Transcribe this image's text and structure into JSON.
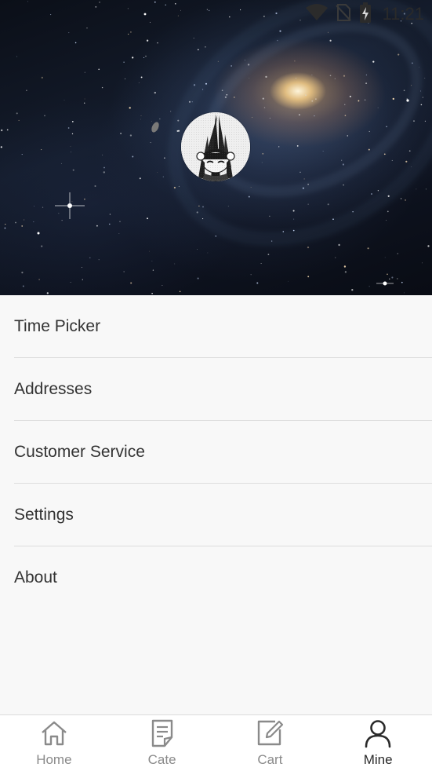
{
  "status_bar": {
    "time": "11:21",
    "icons": [
      "wifi-icon",
      "no-sim-icon",
      "battery-charging-icon"
    ]
  },
  "header": {
    "background": "galaxy-image",
    "avatar": "user-avatar-manga-girl"
  },
  "menu": {
    "items": [
      {
        "label": "Time Picker"
      },
      {
        "label": "Addresses"
      },
      {
        "label": "Customer Service"
      },
      {
        "label": "Settings"
      },
      {
        "label": "About"
      }
    ]
  },
  "tabbar": {
    "tabs": [
      {
        "label": "Home",
        "icon": "home-icon",
        "active": false
      },
      {
        "label": "Cate",
        "icon": "document-icon",
        "active": false
      },
      {
        "label": "Cart",
        "icon": "edit-icon",
        "active": false
      },
      {
        "label": "Mine",
        "icon": "person-icon",
        "active": true
      }
    ]
  },
  "colors": {
    "background": "#f8f8f8",
    "divider": "#dddddd",
    "text": "#333333",
    "tab_inactive": "#8a8a8a",
    "tab_active": "#2a2a2a"
  }
}
